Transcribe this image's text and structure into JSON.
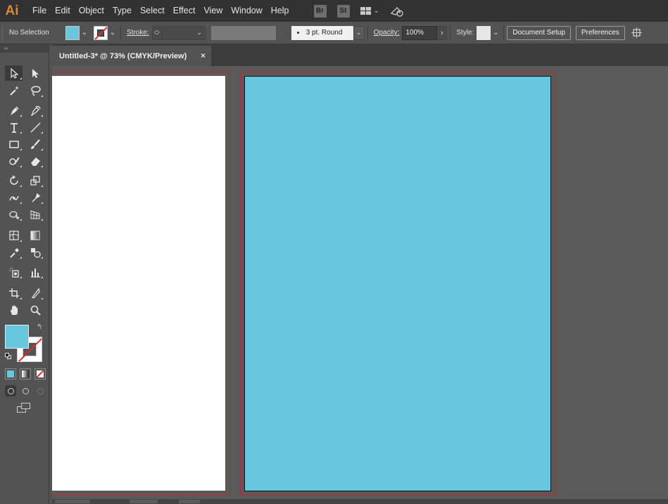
{
  "app": {
    "logo": "Ai"
  },
  "menu": [
    "File",
    "Edit",
    "Object",
    "Type",
    "Select",
    "Effect",
    "View",
    "Window",
    "Help"
  ],
  "app_badges": [
    "Br",
    "St"
  ],
  "control_bar": {
    "selection": "No Selection",
    "fill_color": "#67c7de",
    "stroke_label": "Stroke:",
    "stroke_value": "",
    "brush": "3 pt. Round",
    "opacity_label": "Opacity:",
    "opacity_value": "100%",
    "style_label": "Style:",
    "document_setup": "Document Setup",
    "preferences": "Preferences"
  },
  "toolbar": {
    "collapse": "‹‹",
    "tools": [
      [
        "selection-tool",
        "direct-selection-tool"
      ],
      [
        "magic-wand-tool",
        "lasso-tool"
      ],
      [
        "pen-tool",
        "curvature-tool"
      ],
      [
        "type-tool",
        "line-segment-tool"
      ],
      [
        "rectangle-tool",
        "paintbrush-tool"
      ],
      [
        "shaper-tool",
        "eraser-tool"
      ],
      [
        "rotate-tool",
        "scale-tool"
      ],
      [
        "width-tool",
        "puppet-warp-tool"
      ],
      [
        "shape-builder-tool",
        "perspective-grid-tool"
      ],
      [
        "mesh-tool",
        "gradient-tool"
      ],
      [
        "eyedropper-tool",
        "blend-tool"
      ],
      [
        "symbol-sprayer-tool",
        "column-graph-tool"
      ],
      [
        "artboard-tool",
        "slice-tool"
      ],
      [
        "hand-tool",
        "zoom-tool"
      ]
    ],
    "fill_color": "#67c7de",
    "stroke_color": "#ffffff",
    "swap_symbol": "↰"
  },
  "document": {
    "tab_title": "Untitled-3* @ 73% (CMYK/Preview)",
    "close_symbol": "×",
    "artboard1_color": "#ffffff",
    "artboard2_color": "#67c7de",
    "bleed_color": "#c1272d"
  }
}
